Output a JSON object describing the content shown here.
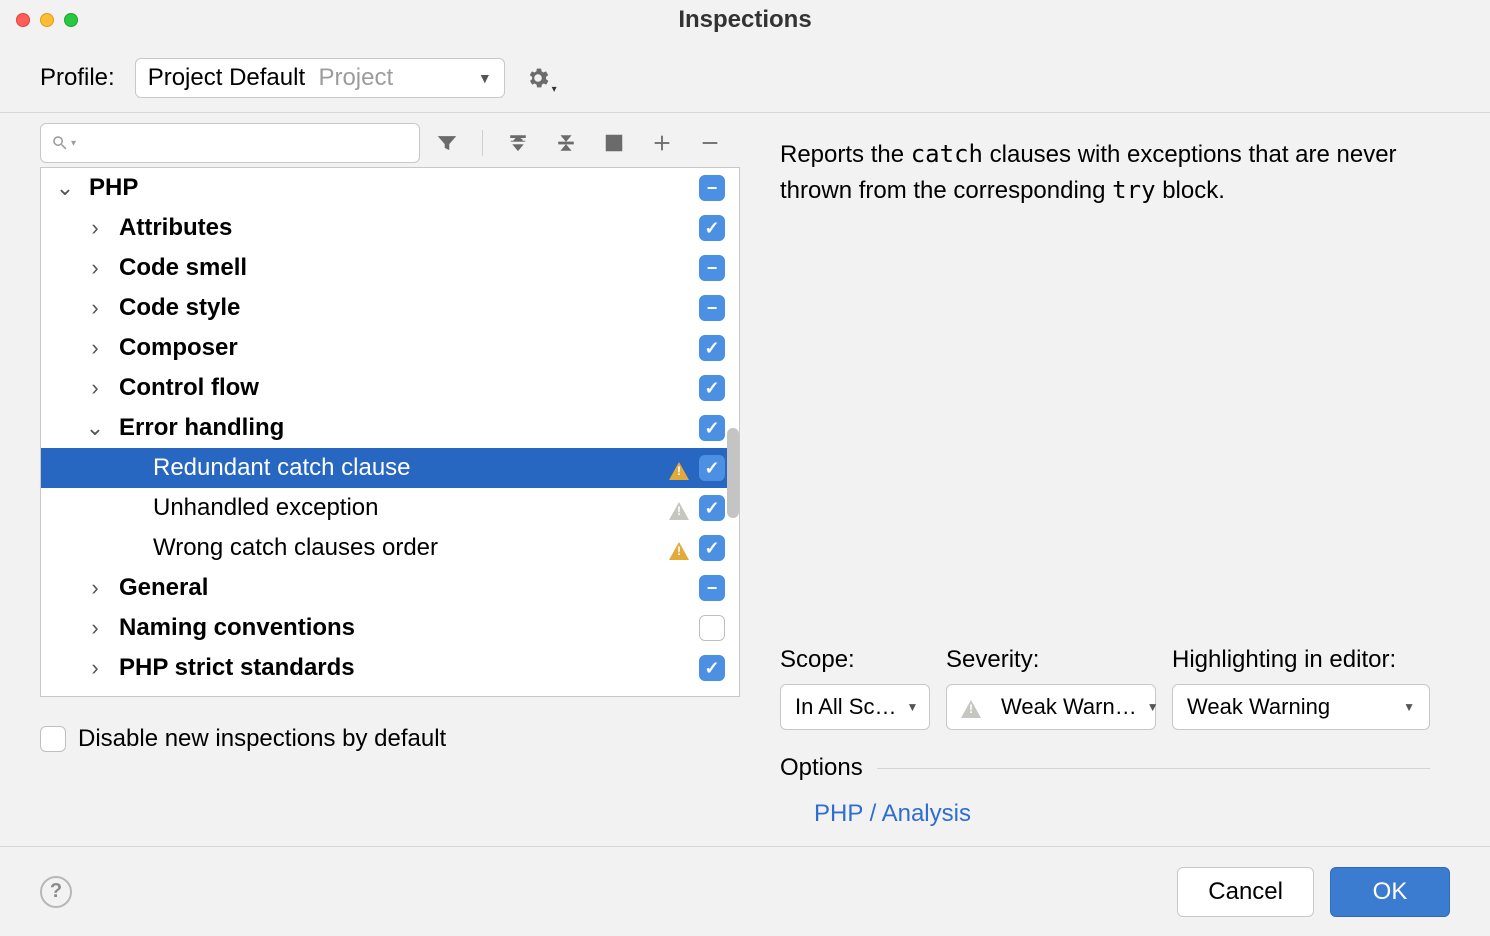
{
  "window": {
    "title": "Inspections"
  },
  "profile": {
    "label": "Profile:",
    "name": "Project Default",
    "scope": "Project"
  },
  "tree": {
    "items": [
      {
        "label": "PHP",
        "indent": 0,
        "expanded": true,
        "leaf": false,
        "check": "mixed"
      },
      {
        "label": "Attributes",
        "indent": 1,
        "expanded": false,
        "leaf": false,
        "check": "checked"
      },
      {
        "label": "Code smell",
        "indent": 1,
        "expanded": false,
        "leaf": false,
        "check": "mixed"
      },
      {
        "label": "Code style",
        "indent": 1,
        "expanded": false,
        "leaf": false,
        "check": "mixed"
      },
      {
        "label": "Composer",
        "indent": 1,
        "expanded": false,
        "leaf": false,
        "check": "checked"
      },
      {
        "label": "Control flow",
        "indent": 1,
        "expanded": false,
        "leaf": false,
        "check": "checked"
      },
      {
        "label": "Error handling",
        "indent": 1,
        "expanded": true,
        "leaf": false,
        "check": "checked"
      },
      {
        "label": "Redundant catch clause",
        "indent": 2,
        "leaf": true,
        "check": "checked",
        "warn": "yellow",
        "selected": true
      },
      {
        "label": "Unhandled exception",
        "indent": 2,
        "leaf": true,
        "check": "checked",
        "warn": "gray"
      },
      {
        "label": "Wrong catch clauses order",
        "indent": 2,
        "leaf": true,
        "check": "checked",
        "warn": "yellow"
      },
      {
        "label": "General",
        "indent": 1,
        "expanded": false,
        "leaf": false,
        "check": "mixed"
      },
      {
        "label": "Naming conventions",
        "indent": 1,
        "expanded": false,
        "leaf": false,
        "check": "empty"
      },
      {
        "label": "PHP strict standards",
        "indent": 1,
        "expanded": false,
        "leaf": false,
        "check": "checked"
      }
    ]
  },
  "disable_label": "Disable new inspections by default",
  "description": {
    "pre": "Reports the ",
    "code1": "catch",
    "mid": " clauses with exceptions that are never thrown from the corresponding ",
    "code2": "try",
    "post": " block."
  },
  "severity": {
    "scope_label": "Scope:",
    "scope_value": "In All Sc…",
    "severity_label": "Severity:",
    "severity_value": "Weak Warn…",
    "highlight_label": "Highlighting in editor:",
    "highlight_value": "Weak Warning"
  },
  "options": {
    "header": "Options",
    "link": "PHP / Analysis"
  },
  "footer": {
    "cancel": "Cancel",
    "ok": "OK"
  }
}
